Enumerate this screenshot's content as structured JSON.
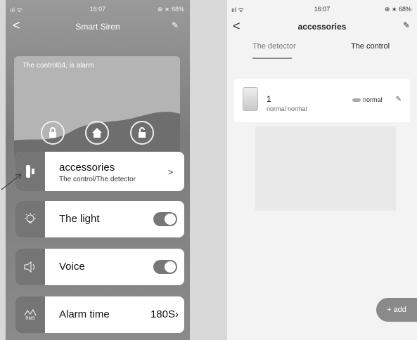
{
  "left": {
    "status": {
      "signal": "ııl ᯤ",
      "time": "16:07",
      "battery": "⊕ ∗ 68%"
    },
    "nav": {
      "back": "<",
      "title": "Smart Siren",
      "edit": "✎"
    },
    "alarm_text": "The control04, is alarm",
    "accessories": {
      "title": "accessories",
      "subtitle": "The control/The detector",
      "chevron": ">"
    },
    "light": {
      "label": "The light",
      "on": true
    },
    "voice": {
      "label": "Voice",
      "on": true
    },
    "alarm_time": {
      "label": "Alarm time",
      "value": "180S›",
      "icon_caption": "RMS"
    }
  },
  "right": {
    "status": {
      "signal": "ııl ᯤ",
      "time": "16:07",
      "battery": "⊕ ∗ 68%"
    },
    "nav": {
      "back": "<",
      "title": "accessories",
      "edit": "✎"
    },
    "tabs": [
      {
        "label": "The detector",
        "active": true
      },
      {
        "label": "The control",
        "active": false
      }
    ],
    "device": {
      "name": "1",
      "subtitle": "normal normal",
      "status": "normal"
    },
    "add_button": "+ add"
  },
  "colors": {
    "card_icon_bg": "#757575",
    "toggle_on": "#777777"
  }
}
